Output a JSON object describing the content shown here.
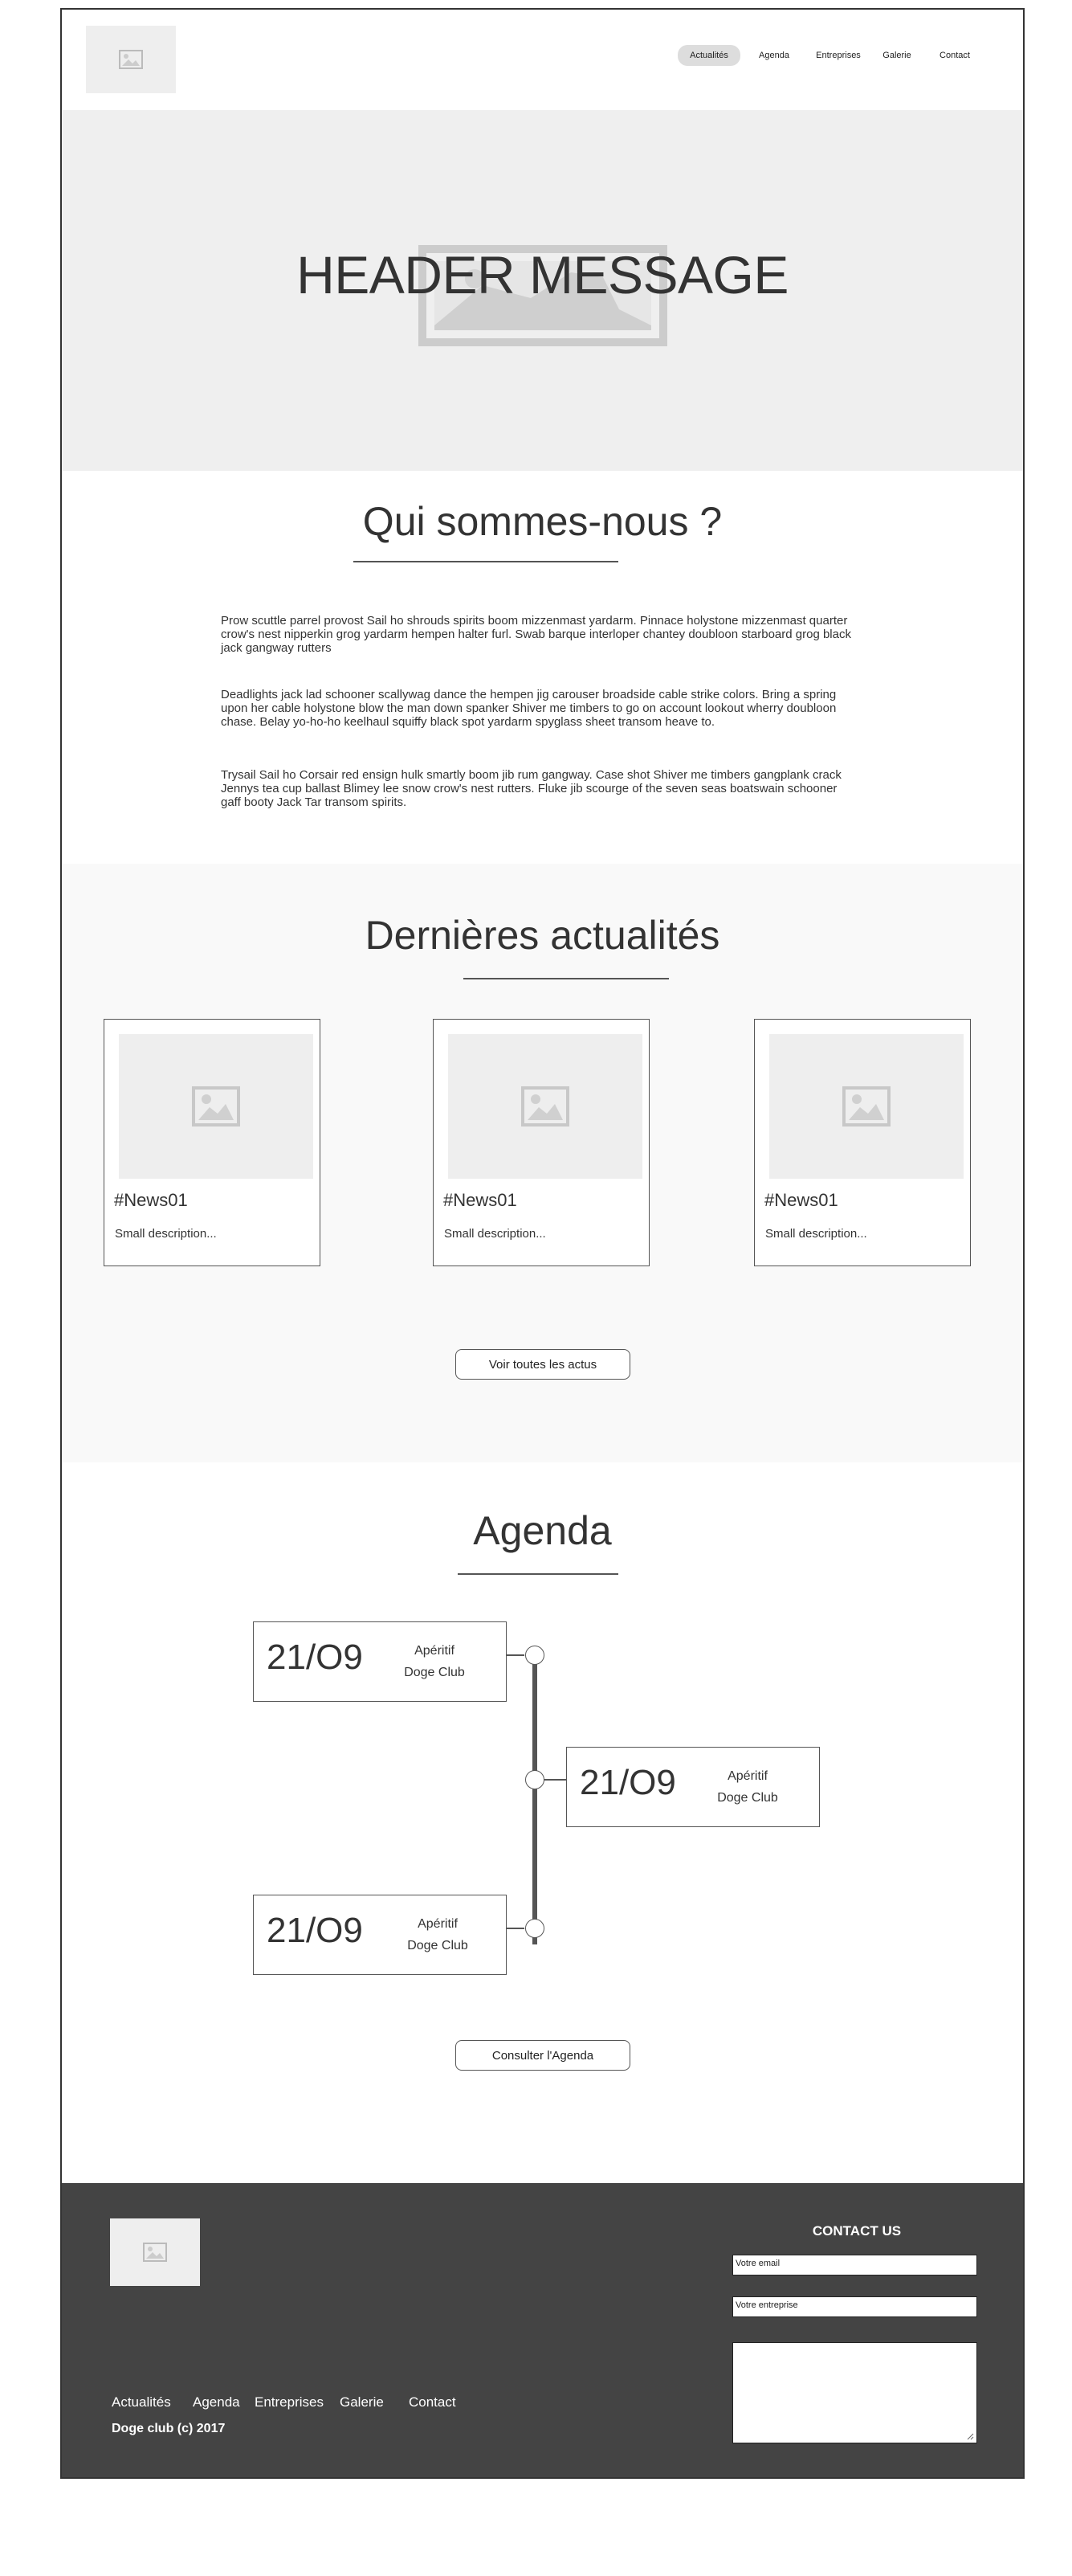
{
  "nav": {
    "logo_icon": "image-placeholder-icon",
    "items": [
      {
        "label": "Actualités",
        "active": true
      },
      {
        "label": "Agenda",
        "active": false
      },
      {
        "label": "Entreprises",
        "active": false
      },
      {
        "label": "Galerie",
        "active": false
      },
      {
        "label": "Contact",
        "active": false
      }
    ]
  },
  "hero": {
    "title": "HEADER MESSAGE",
    "bg_icon": "image-placeholder-icon"
  },
  "about": {
    "title": "Qui sommes-nous ?",
    "paragraphs": [
      "Prow scuttle parrel provost Sail ho shrouds spirits boom mizzenmast yardarm. Pinnace holystone mizzenmast quarter crow's nest nipperkin grog yardarm hempen halter furl. Swab barque interloper chantey doubloon starboard grog black jack gangway rutters",
      "Deadlights jack lad schooner scallywag dance the hempen jig carouser broadside cable strike colors. Bring a spring upon her cable holystone blow the man down spanker Shiver me timbers to go on account lookout wherry doubloon chase. Belay yo-ho-ho keelhaul squiffy black spot yardarm spyglass sheet transom heave to.",
      "Trysail Sail ho Corsair red ensign hulk smartly boom jib rum gangway. Case shot Shiver me timbers gangplank crack Jennys tea cup ballast Blimey lee snow crow's nest rutters. Fluke jib scourge of the seven seas boatswain schooner gaff booty Jack Tar transom spirits."
    ]
  },
  "news": {
    "title": "Dernières actualités",
    "cards": [
      {
        "title": "#News01",
        "description": "Small description...",
        "icon": "image-placeholder-icon"
      },
      {
        "title": "#News01",
        "description": "Small description...",
        "icon": "image-placeholder-icon"
      },
      {
        "title": "#News01",
        "description": "Small description...",
        "icon": "image-placeholder-icon"
      }
    ],
    "button_label": "Voir toutes les actus"
  },
  "agenda": {
    "title": "Agenda",
    "events": [
      {
        "date": "21/O9",
        "line1": "Apéritif",
        "line2": "Doge Club"
      },
      {
        "date": "21/O9",
        "line1": "Apéritif",
        "line2": "Doge Club"
      },
      {
        "date": "21/O9",
        "line1": "Apéritif",
        "line2": "Doge Club"
      }
    ],
    "button_label": "Consulter l'Agenda"
  },
  "footer": {
    "logo_icon": "image-placeholder-icon",
    "contact_title": "CONTACT US",
    "email_placeholder": "Votre email",
    "company_placeholder": "Votre entreprise",
    "links": [
      "Actualités",
      "Agenda",
      "Entreprises",
      "Galerie",
      "Contact"
    ],
    "copyright": "Doge club (c) 2017"
  },
  "colors": {
    "footer_bg": "#444444",
    "hero_bg": "#efefef",
    "active_nav_bg": "#dddddd",
    "section_alt_bg": "#f9f9f9"
  }
}
